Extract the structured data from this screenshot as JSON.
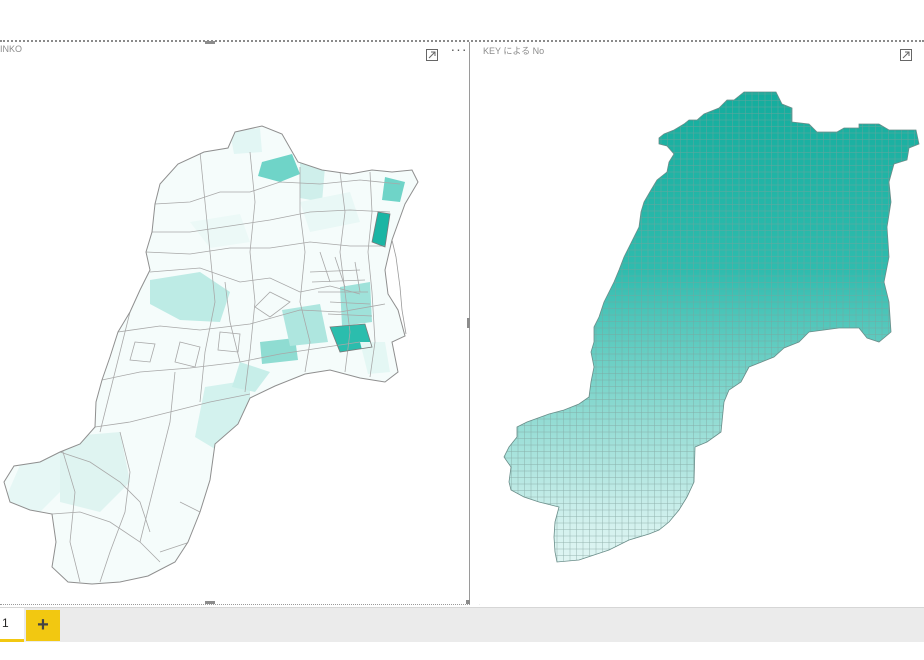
{
  "report": {
    "left_visual": {
      "title": "INKO",
      "focus_icon": "focus-mode-icon",
      "more_icon": "more-options-icon",
      "more_label": "···"
    },
    "right_visual": {
      "title": "KEY による No",
      "focus_icon": "focus-mode-icon"
    },
    "colors": {
      "map_high": "#1bb5a4",
      "map_mid": "#7fd8ce",
      "map_low": "#d9f3f0",
      "map_lowest": "#f5fcfb",
      "boundary": "#9a9a9a",
      "accent_yellow": "#f2c811"
    }
  },
  "pages": {
    "tabs": [
      {
        "label": "1"
      }
    ],
    "add_label": "+"
  }
}
